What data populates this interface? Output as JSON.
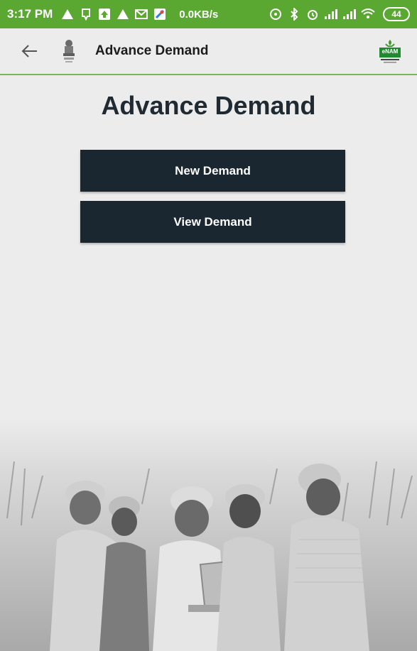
{
  "status_bar": {
    "time": "3:17 PM",
    "network_speed": "0.0KB/s",
    "battery": "44",
    "background_color": "#5aa832"
  },
  "app_bar": {
    "title": "Advance Demand",
    "back_icon": "arrow-left-icon",
    "emblem_icon": "national-emblem-icon",
    "logo_text": "eNAM"
  },
  "main": {
    "heading": "Advance Demand",
    "buttons": [
      {
        "label": "New Demand"
      },
      {
        "label": "View Demand"
      }
    ],
    "button_color": "#1b2730"
  },
  "colors": {
    "accent_line": "#7cb65a",
    "background": "#ececec",
    "heading": "#1f2a32"
  }
}
